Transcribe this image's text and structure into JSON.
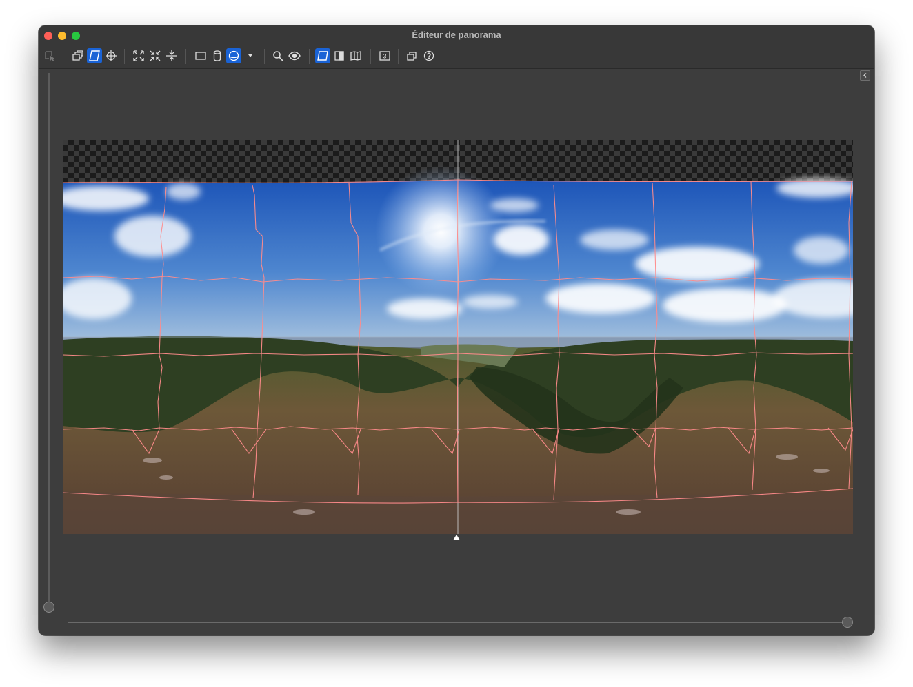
{
  "window": {
    "title": "Éditeur de panorama"
  },
  "toolbar": {
    "buttons": [
      {
        "name": "select-images-button",
        "icon": "select-cursor-icon",
        "active": false
      },
      {
        "name": "overlap-view-button",
        "icon": "stacked-images-icon",
        "active": false
      },
      {
        "name": "seam-view-button",
        "icon": "seam-edit-icon",
        "active": true
      },
      {
        "name": "control-points-button",
        "icon": "crosshair-icon",
        "active": false
      },
      {
        "name": "fit-button",
        "icon": "expand-arrows-icon",
        "active": false
      },
      {
        "name": "shrink-button",
        "icon": "compress-arrows-icon",
        "active": false
      },
      {
        "name": "straighten-horizon-button",
        "icon": "horizon-level-icon",
        "active": false
      },
      {
        "name": "projection-rectilinear-button",
        "icon": "rectangle-icon",
        "active": false
      },
      {
        "name": "projection-cylindrical-button",
        "icon": "cylinder-icon",
        "active": false
      },
      {
        "name": "projection-spherical-button",
        "icon": "sphere-icon",
        "active": true
      },
      {
        "name": "projection-dropdown-button",
        "icon": "dropdown-triangle-icon",
        "active": false
      },
      {
        "name": "zoom-button",
        "icon": "magnifier-icon",
        "active": false
      },
      {
        "name": "preview-button",
        "icon": "eye-icon",
        "active": false
      },
      {
        "name": "view-mode-outline-button",
        "icon": "outline-frame-icon",
        "active": true
      },
      {
        "name": "view-mode-split-button",
        "icon": "half-filled-frame-icon",
        "active": false
      },
      {
        "name": "view-mode-warp-button",
        "icon": "warped-frame-icon",
        "active": false
      },
      {
        "name": "image-count-button",
        "icon": "number-badge-icon",
        "active": false
      },
      {
        "name": "layers-button",
        "icon": "layers-icon",
        "active": false
      },
      {
        "name": "help-button",
        "icon": "help-circle-icon",
        "active": false
      }
    ],
    "image_count_label": "3"
  },
  "colors": {
    "seam_line": "#ff8c8c",
    "accent": "#1a63d6"
  }
}
